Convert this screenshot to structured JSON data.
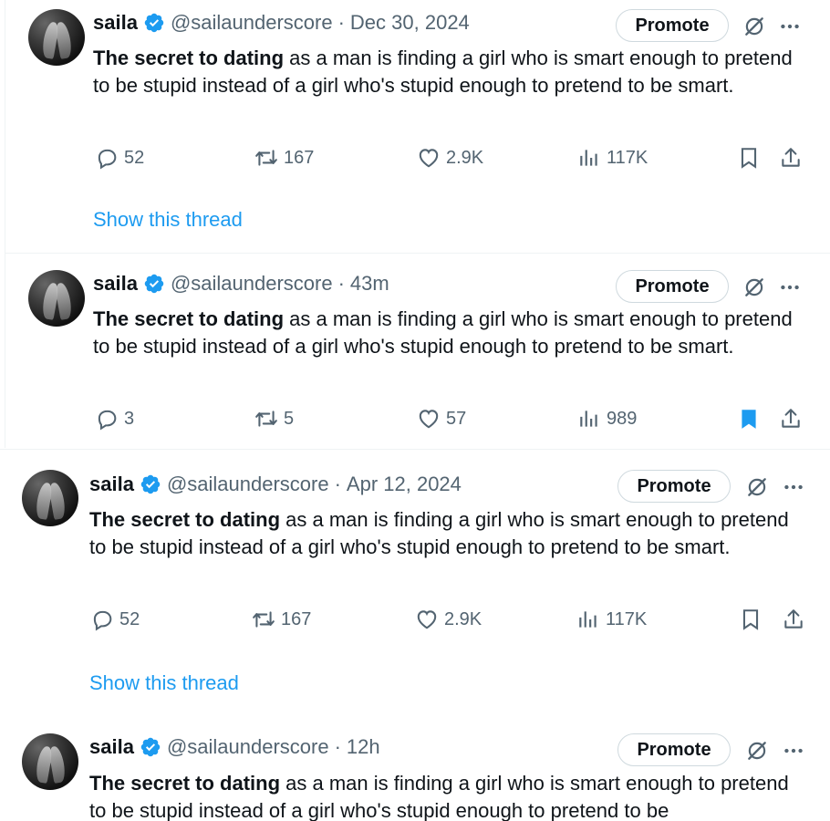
{
  "tweets": [
    {
      "author": "saila",
      "handle": "@sailaunderscore",
      "time": "Dec 30, 2024",
      "promote": "Promote",
      "text_bold": "The secret to dating",
      "text_rest": " as a man is finding a girl who is smart enough to pretend to be stupid instead of a girl who's stupid enough to pretend to be smart.",
      "replies": "52",
      "reposts": "167",
      "likes": "2.9K",
      "views": "117K",
      "bookmarked": false,
      "thread_link": "Show this thread"
    },
    {
      "author": "saila",
      "handle": "@sailaunderscore",
      "time": "43m",
      "promote": "Promote",
      "text_bold": "The secret to dating",
      "text_rest": " as a man is finding a girl who is smart enough to pretend to be stupid instead of a girl who's stupid enough to pretend to be smart.",
      "replies": "3",
      "reposts": "5",
      "likes": "57",
      "views": "989",
      "bookmarked": true
    },
    {
      "author": "saila",
      "handle": "@sailaunderscore",
      "time": "Apr 12, 2024",
      "promote": "Promote",
      "text_bold": "The secret to dating",
      "text_rest": " as a man is finding a girl who is smart enough to pretend to be stupid instead of a girl who's stupid enough to pretend to be smart.",
      "replies": "52",
      "reposts": "167",
      "likes": "2.9K",
      "views": "117K",
      "bookmarked": false,
      "thread_link": "Show this thread"
    },
    {
      "author": "saila",
      "handle": "@sailaunderscore",
      "time": "12h",
      "promote": "Promote",
      "text_bold": "The secret to dating",
      "text_rest": " as a man is finding a girl who is smart enough to pretend to be stupid instead of a girl who's stupid enough to pretend to be"
    }
  ],
  "separator": "·",
  "colors": {
    "accent": "#1d9bf0",
    "muted": "#536471",
    "text": "#0f1419"
  },
  "icons": [
    "verified-badge-icon",
    "grok-icon",
    "more-icon",
    "reply-icon",
    "repost-icon",
    "like-icon",
    "views-icon",
    "bookmark-icon",
    "share-icon"
  ]
}
